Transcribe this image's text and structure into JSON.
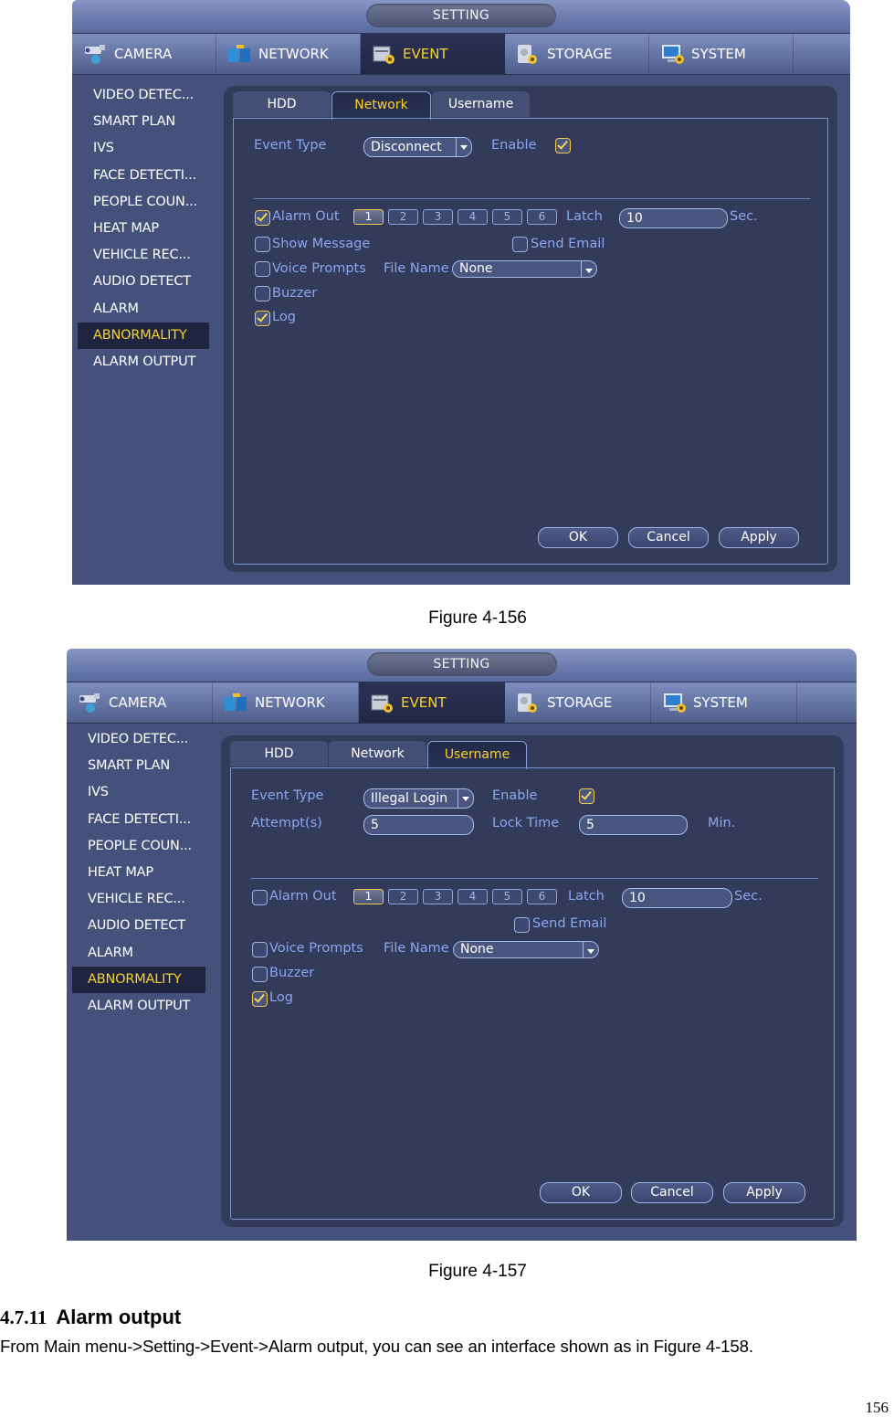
{
  "figures": [
    {
      "window_title": "SETTING",
      "top_tabs": [
        {
          "label": "CAMERA",
          "icon": "camera-icon"
        },
        {
          "label": "NETWORK",
          "icon": "network-icon"
        },
        {
          "label": "EVENT",
          "icon": "event-icon",
          "active": true
        },
        {
          "label": "STORAGE",
          "icon": "storage-icon"
        },
        {
          "label": "SYSTEM",
          "icon": "system-icon"
        }
      ],
      "side_menu": [
        "VIDEO DETEC...",
        "SMART PLAN",
        "IVS",
        "FACE DETECTI...",
        "PEOPLE COUN...",
        "HEAT MAP",
        "VEHICLE REC...",
        "AUDIO DETECT",
        "ALARM",
        "ABNORMALITY",
        "ALARM OUTPUT"
      ],
      "side_menu_active": "ABNORMALITY",
      "sub_tabs": [
        "HDD",
        "Network",
        "Username"
      ],
      "sub_tab_active": "Network",
      "event_type_label": "Event Type",
      "event_type_value": "Disconnect",
      "enable_label": "Enable",
      "enable_checked": true,
      "alarm_out_label": "Alarm Out",
      "alarm_out_checked": true,
      "channels": [
        "1",
        "2",
        "3",
        "4",
        "5",
        "6"
      ],
      "channel_active": "1",
      "latch_label": "Latch",
      "latch_value": "10",
      "latch_unit": "Sec.",
      "show_message_label": "Show Message",
      "show_message_checked": false,
      "send_email_label": "Send Email",
      "send_email_checked": false,
      "voice_prompts_label": "Voice Prompts",
      "voice_prompts_checked": false,
      "file_name_label": "File Name",
      "file_name_value": "None",
      "buzzer_label": "Buzzer",
      "buzzer_checked": false,
      "log_label": "Log",
      "log_checked": true,
      "buttons": {
        "ok": "OK",
        "cancel": "Cancel",
        "apply": "Apply"
      },
      "caption": "Figure 4-156"
    },
    {
      "window_title": "SETTING",
      "top_tabs": [
        {
          "label": "CAMERA",
          "icon": "camera-icon"
        },
        {
          "label": "NETWORK",
          "icon": "network-icon"
        },
        {
          "label": "EVENT",
          "icon": "event-icon",
          "active": true
        },
        {
          "label": "STORAGE",
          "icon": "storage-icon"
        },
        {
          "label": "SYSTEM",
          "icon": "system-icon"
        }
      ],
      "side_menu": [
        "VIDEO DETEC...",
        "SMART PLAN",
        "IVS",
        "FACE DETECTI...",
        "PEOPLE COUN...",
        "HEAT MAP",
        "VEHICLE REC...",
        "AUDIO DETECT",
        "ALARM",
        "ABNORMALITY",
        "ALARM OUTPUT"
      ],
      "side_menu_active": "ABNORMALITY",
      "sub_tabs": [
        "HDD",
        "Network",
        "Username"
      ],
      "sub_tab_active": "Username",
      "event_type_label": "Event Type",
      "event_type_value": "Illegal Login",
      "enable_label": "Enable",
      "enable_checked": true,
      "attempts_label": "Attempt(s)",
      "attempts_value": "5",
      "lock_time_label": "Lock Time",
      "lock_time_value": "5",
      "lock_time_unit": "Min.",
      "alarm_out_label": "Alarm Out",
      "alarm_out_checked": false,
      "channels": [
        "1",
        "2",
        "3",
        "4",
        "5",
        "6"
      ],
      "channel_active": "1",
      "latch_label": "Latch",
      "latch_value": "10",
      "latch_unit": "Sec.",
      "send_email_label": "Send Email",
      "send_email_checked": false,
      "voice_prompts_label": "Voice Prompts",
      "voice_prompts_checked": false,
      "file_name_label": "File Name",
      "file_name_value": "None",
      "buzzer_label": "Buzzer",
      "buzzer_checked": false,
      "log_label": "Log",
      "log_checked": true,
      "buttons": {
        "ok": "OK",
        "cancel": "Cancel",
        "apply": "Apply"
      },
      "caption": "Figure 4-157"
    }
  ],
  "section": {
    "number": "4.7.11",
    "title": "Alarm output",
    "body": "From Main menu->Setting->Event->Alarm output, you can see an interface shown as in Figure 4-158."
  },
  "page_number": "156",
  "colors": {
    "accent_active": "#f8d22b",
    "label_blue": "#8ca6ee",
    "panel_bg": "#333a5a",
    "window_bg": "#45517a"
  }
}
